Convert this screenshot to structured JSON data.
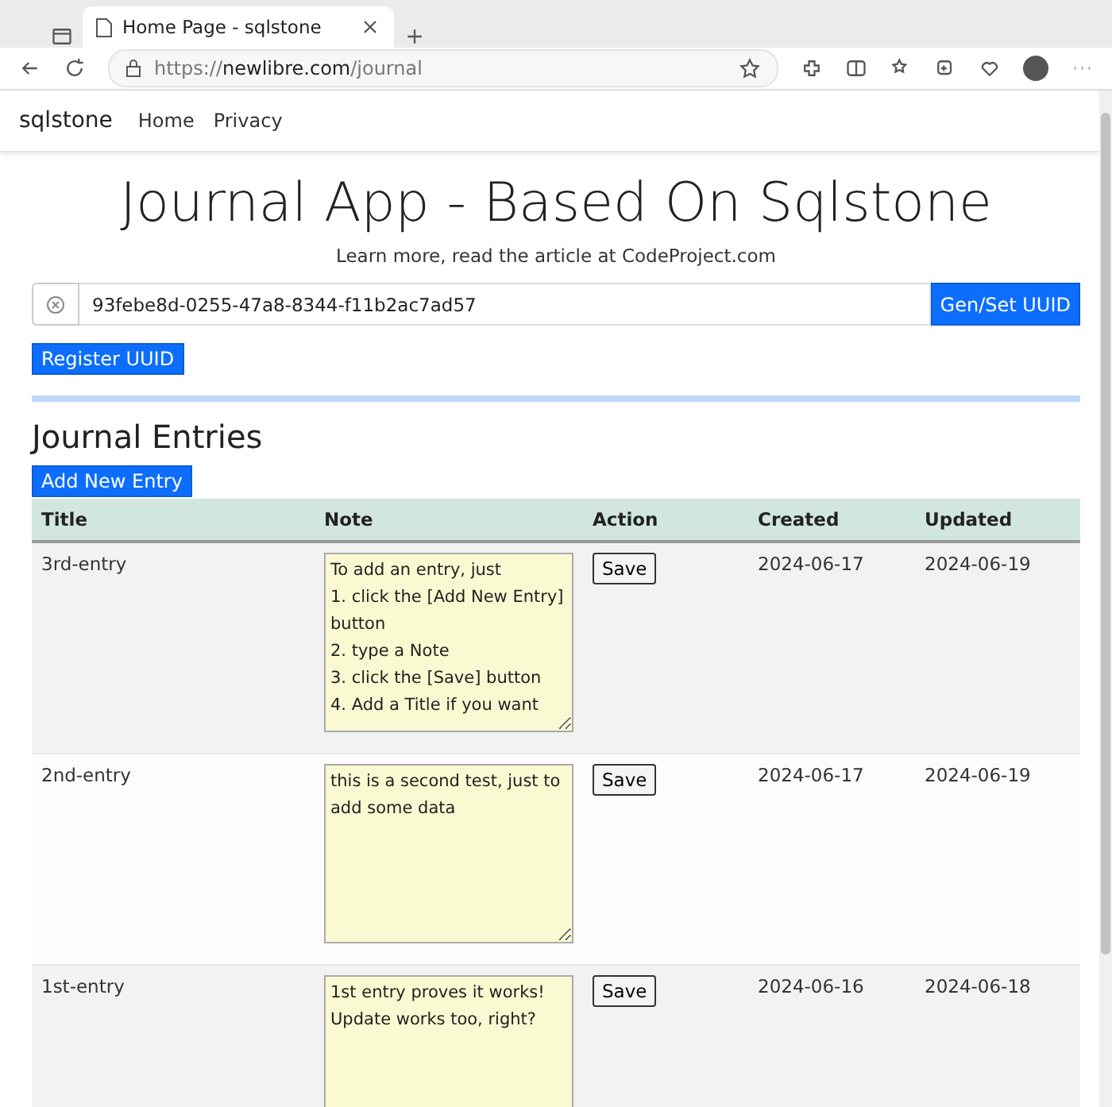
{
  "browser": {
    "tab_title": "Home Page - sqlstone",
    "url_prefix": "https://",
    "url_host": "newlibre.com",
    "url_path": "/journal"
  },
  "navbar": {
    "brand": "sqlstone",
    "links": [
      "Home",
      "Privacy"
    ]
  },
  "header": {
    "title": "Journal App - Based On Sqlstone",
    "subtitle": "Learn more, read the article at CodeProject.com"
  },
  "uuid": {
    "value": "93febe8d-0255-47a8-8344-f11b2ac7ad57",
    "set_button": "Gen/Set UUID",
    "register_button": "Register UUID"
  },
  "journal": {
    "heading": "Journal Entries",
    "add_button": "Add New Entry",
    "columns": [
      "Title",
      "Note",
      "Action",
      "Created",
      "Updated"
    ],
    "rows": [
      {
        "title": "3rd-entry",
        "note": "To add an entry, just\n1. click the [Add New Entry] button\n2. type a Note\n3. click the [Save] button\n4. Add a Title if you want",
        "action": "Save",
        "created": "2024-06-17",
        "updated": "2024-06-19"
      },
      {
        "title": "2nd-entry",
        "note": "this is a second test, just to add some data",
        "action": "Save",
        "created": "2024-06-17",
        "updated": "2024-06-19"
      },
      {
        "title": "1st-entry",
        "note": "1st entry proves it works!\nUpdate works too, right?",
        "action": "Save",
        "created": "2024-06-16",
        "updated": "2024-06-18"
      }
    ]
  }
}
